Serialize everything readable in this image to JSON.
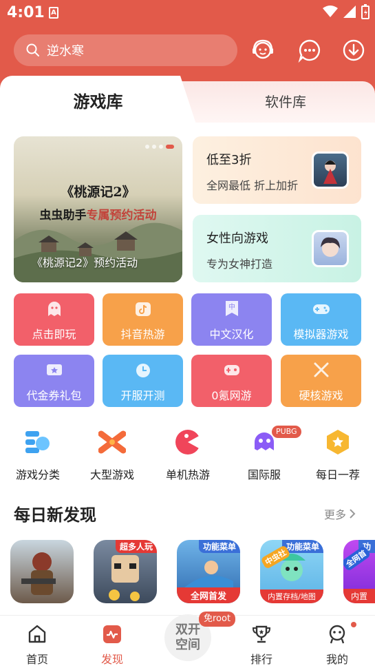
{
  "status_bar": {
    "time": "4:01",
    "app_badge": "A"
  },
  "search": {
    "placeholder": "逆水寒"
  },
  "header_icons": [
    "customer-service-icon",
    "message-icon",
    "download-icon"
  ],
  "tabs": [
    {
      "label": "游戏库",
      "active": true
    },
    {
      "label": "软件库",
      "active": false
    }
  ],
  "banner": {
    "title_line1": "《桃源记2》",
    "title_line2_a": "虫虫助手",
    "title_line2_b": "专属预约活动",
    "caption": "《桃源记2》预约活动"
  },
  "promos": [
    {
      "title": "低至3折",
      "subtitle": "全网最低 折上加折"
    },
    {
      "title": "女性向游戏",
      "subtitle": "专为女神打造"
    }
  ],
  "categories": [
    {
      "label": "点击即玩",
      "color": "#f2606a"
    },
    {
      "label": "抖音热游",
      "color": "#f7a14a"
    },
    {
      "label": "中文汉化",
      "color": "#8c84f0"
    },
    {
      "label": "模拟器游戏",
      "color": "#5ab8f4"
    },
    {
      "label": "代金券礼包",
      "color": "#8c84f0"
    },
    {
      "label": "开服开测",
      "color": "#5ab8f4"
    },
    {
      "label": "0氪网游",
      "color": "#f2606a"
    },
    {
      "label": "硬核游戏",
      "color": "#f7a14a"
    }
  ],
  "quick_icons": [
    {
      "label": "游戏分类",
      "icon": "category-icon"
    },
    {
      "label": "大型游戏",
      "icon": "large-game-icon"
    },
    {
      "label": "单机热游",
      "icon": "offline-game-icon"
    },
    {
      "label": "国际服",
      "icon": "international-icon",
      "badge": "PUBG"
    },
    {
      "label": "每日一荐",
      "icon": "daily-pick-icon"
    }
  ],
  "section": {
    "title": "每日新发现",
    "more": "更多"
  },
  "games": [
    {
      "tag": "",
      "bottom": ""
    },
    {
      "tag": "超多人玩",
      "bottom": ""
    },
    {
      "tag": "功能菜单",
      "bottom": "全网首发"
    },
    {
      "tag": "功能菜单",
      "bottom": "内置存档/地图",
      "corner": "中虫社"
    },
    {
      "tag": "功",
      "bottom": "内置",
      "corner": "全网首"
    }
  ],
  "bottom_nav": [
    {
      "label": "首页",
      "icon": "home-icon"
    },
    {
      "label": "发现",
      "icon": "discover-icon",
      "active": true
    },
    {
      "label": "排行",
      "icon": "trophy-icon"
    },
    {
      "label": "我的",
      "icon": "profile-icon"
    }
  ],
  "center_button": {
    "label_line1": "双开",
    "label_line2": "空间",
    "badge": "免root"
  },
  "colors": {
    "primary": "#e25a4a"
  }
}
